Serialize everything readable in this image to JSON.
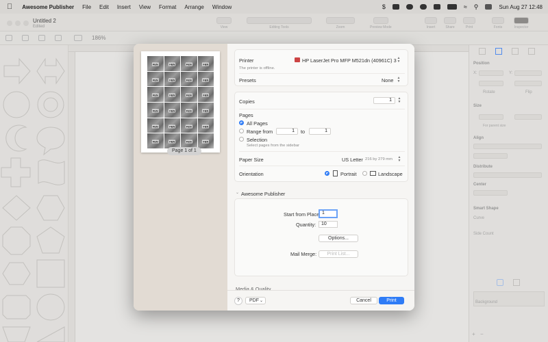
{
  "menubar": {
    "app_name": "Awesome Publisher",
    "items": [
      "File",
      "Edit",
      "Insert",
      "View",
      "Format",
      "Arrange",
      "Window"
    ],
    "datetime": "Sun Aug 27  12:48"
  },
  "window": {
    "doc_title": "Untitled 2",
    "doc_status": "Edited",
    "toolbar_groups": [
      "View",
      "Editing Tools",
      "Zoom",
      "Preview Mode",
      "Insert",
      "Share",
      "Print",
      "Fonts",
      "Inspector"
    ],
    "zoom": "186%"
  },
  "inspector": {
    "position": "Position",
    "x_label": "X:",
    "y_label": "Y:",
    "rotate": "Rotate",
    "flip": "Flip",
    "size": "Size",
    "for_parent": "For parent size",
    "align": "Align",
    "distribute": "Distribute",
    "center": "Center",
    "smart_shape": "Smart Shape",
    "curve": "Curve",
    "side_count": "Side Count",
    "layer": "Background"
  },
  "print_dialog": {
    "preview": {
      "page_label": "Page 1 of 1",
      "thumb_text": "FEN"
    },
    "printer": {
      "label": "Printer",
      "value": "HP LaserJet Pro MFP M521dn (40961C) 3",
      "status": "The printer is offline."
    },
    "presets": {
      "label": "Presets",
      "value": "None"
    },
    "copies": {
      "label": "Copies",
      "value": "1"
    },
    "pages": {
      "label": "Pages",
      "all": "All Pages",
      "range": "Range from",
      "from": "1",
      "to_label": "to",
      "to": "1",
      "selection": "Selection",
      "selection_hint": "Select pages from the sidebar"
    },
    "paper": {
      "label": "Paper Size",
      "value": "US Letter",
      "dims": "216 by 279 mm"
    },
    "orientation": {
      "label": "Orientation",
      "portrait": "Portrait",
      "landscape": "Landscape"
    },
    "app_section": {
      "title": "Awesome Publisher",
      "start_label": "Start from Place:",
      "start_value": "1",
      "quantity_label": "Quantity:",
      "quantity_value": "10",
      "options_btn": "Options...",
      "mail_merge_label": "Mail Merge:",
      "print_list_btn": "Print List..."
    },
    "media_quality": "Media & Quality",
    "footer": {
      "help": "?",
      "pdf": "PDF",
      "cancel": "Cancel",
      "print": "Print"
    }
  },
  "colors": {
    "accent": "#2f7cf6"
  }
}
